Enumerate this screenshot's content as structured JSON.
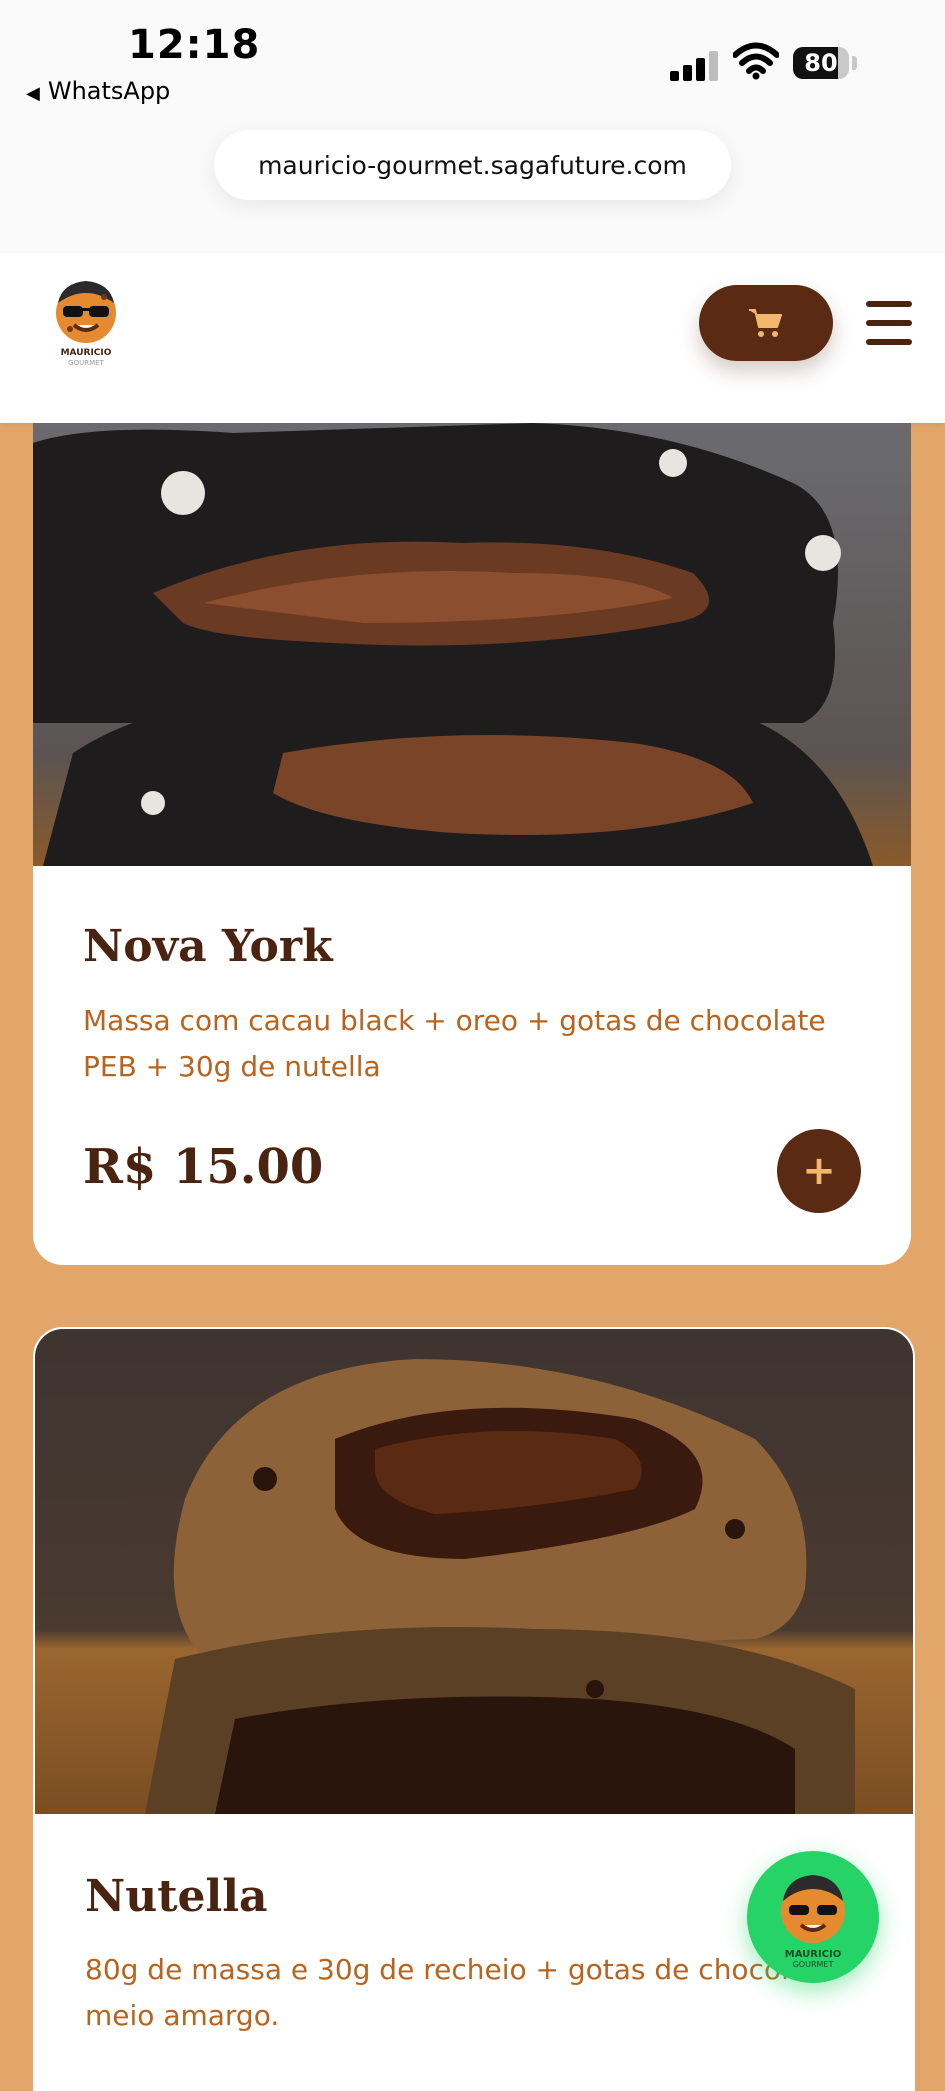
{
  "status_bar": {
    "time": "12:18",
    "back_label": "WhatsApp",
    "battery_level": "80"
  },
  "browser": {
    "url": "mauricio-gourmet.sagafuture.com"
  },
  "header": {
    "logo_text": "MAURICIO",
    "logo_subtext": "GOURMET",
    "cart_icon": "cart-icon",
    "menu_icon": "hamburger-menu-icon"
  },
  "products": [
    {
      "name": "Nova York",
      "description": "Massa com cacau black + oreo + gotas de chocolate PEB + 30g de nutella",
      "price": "R$ 15.00",
      "add_label": "+"
    },
    {
      "name": "Nutella",
      "description": "80g de massa e 30g de recheio + gotas de chocolate meio amargo."
    }
  ],
  "colors": {
    "page_bg": "#E3A66A",
    "brand_brown": "#5A2B12",
    "title_brown": "#4A2410",
    "desc_orange": "#B8641E",
    "whatsapp_green": "#25D366"
  }
}
